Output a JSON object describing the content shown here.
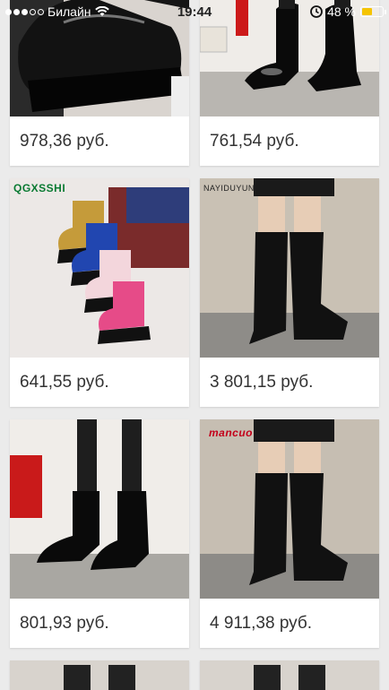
{
  "status_bar": {
    "carrier": "Билайн",
    "time": "19:44",
    "battery_percent": "48 %",
    "battery_level": 0.48,
    "battery_color": "#f5c400"
  },
  "products": [
    {
      "price": "978,36 руб.",
      "image": "black-platform-boots-photo"
    },
    {
      "price": "761,54 руб.",
      "image": "patent-chelsea-boots-photo"
    },
    {
      "price": "641,55 руб.",
      "image": "kids-snow-boots-photo",
      "brand": "QGXSSHI"
    },
    {
      "price": "3 801,15 руб.",
      "image": "over-knee-boots-photo",
      "brand": "NAYIDUYUN"
    },
    {
      "price": "801,93 руб.",
      "image": "patent-chelsea-boots-legs-photo"
    },
    {
      "price": "4 911,38 руб.",
      "image": "over-knee-boots-photo-2",
      "brand": "mancuo"
    },
    {
      "price": "",
      "image": "boots-photo-partial"
    },
    {
      "price": "",
      "image": "boots-photo-partial"
    }
  ]
}
